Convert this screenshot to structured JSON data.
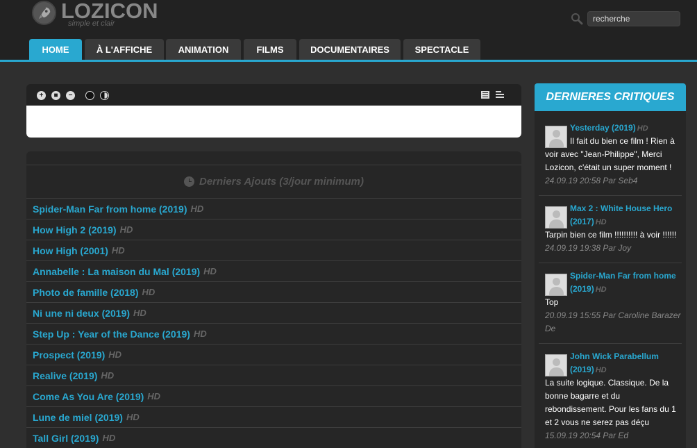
{
  "header": {
    "logo_text": "LOZICON",
    "tagline": "simple et clair",
    "search_placeholder": "recherche"
  },
  "nav": {
    "tabs": [
      "HOME",
      "À L'AFFICHE",
      "ANIMATION",
      "FILMS",
      "DOCUMENTAIRES",
      "SPECTACLE"
    ],
    "active": "HOME"
  },
  "latest": {
    "title": "Derniers Ajouts (3/jour minimum)",
    "films": [
      {
        "title": "Spider-Man Far from home (2019)",
        "quality": "HD"
      },
      {
        "title": "How High 2 (2019)",
        "quality": "HD"
      },
      {
        "title": "How High (2001)",
        "quality": "HD"
      },
      {
        "title": "Annabelle : La maison du Mal (2019)",
        "quality": "HD"
      },
      {
        "title": "Photo de famille (2018)",
        "quality": "HD"
      },
      {
        "title": "Ni une ni deux (2019)",
        "quality": "HD"
      },
      {
        "title": "Step Up : Year of the Dance (2019)",
        "quality": "HD"
      },
      {
        "title": "Prospect (2019)",
        "quality": "HD"
      },
      {
        "title": "Realive (2019)",
        "quality": "HD"
      },
      {
        "title": "Come As You Are (2019)",
        "quality": "HD"
      },
      {
        "title": "Lune de miel (2019)",
        "quality": "HD"
      },
      {
        "title": "Tall Girl (2019)",
        "quality": "HD"
      }
    ]
  },
  "sidebar": {
    "title": "DERNIERES CRITIQUES",
    "reviews": [
      {
        "title_line1": "Yesterday (2019)",
        "title_line2": "",
        "quality": "HD",
        "text_side": [
          "Il fait du bien ce film ! Rien à"
        ],
        "text_full": [
          "voir avec \"Jean-Philippe\", Merci",
          "Lozicon, c'était un super moment !"
        ],
        "meta": [
          "24.09.19 20:58 Par Seb4"
        ]
      },
      {
        "title_line1": "Max 2 : White House Hero",
        "title_line2": "(2017)",
        "quality": "HD",
        "text_side": [],
        "text_full": [
          "Tarpin bien ce film !!!!!!!!!! à voir !!!!!!"
        ],
        "meta": [
          "24.09.19 19:38 Par Joy"
        ]
      },
      {
        "title_line1": "Spider-Man Far from home",
        "title_line2": "(2019)",
        "quality": "HD",
        "text_side": [],
        "text_full": [
          "Top"
        ],
        "meta": [
          "20.09.19 15:55 Par Caroline Barazer",
          "De"
        ]
      },
      {
        "title_line1": "John Wick Parabellum",
        "title_line2": "(2019)",
        "quality": "HD",
        "text_side": [],
        "text_full": [
          "La suite logique. Classique. De la",
          "bonne bagarre et du",
          "rebondissement. Pour les fans du 1",
          "et 2 vous ne serez pas déçu"
        ],
        "meta": [
          "15.09.19 20:54 Par Ed"
        ]
      }
    ]
  }
}
